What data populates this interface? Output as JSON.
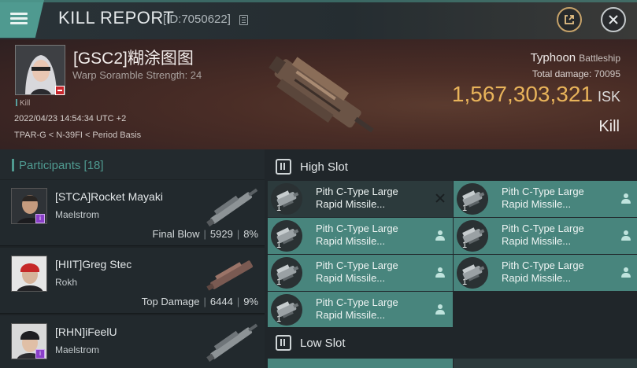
{
  "header": {
    "title": "KILL REPORT",
    "kill_id": "[ID:7050622]",
    "icons": {
      "menu": "hamburger-menu-icon",
      "copy": "copy-icon",
      "share": "share-icon",
      "close": "close-icon"
    }
  },
  "victim": {
    "name": "[GSC2]糊涂图图",
    "warp_scramble": "Warp Soramble Strength: 24",
    "status_tag": "Kill",
    "datetime": "2022/04/23 14:54:34 UTC +2",
    "location": "TPAR-G < N-39FI < Period Basis",
    "ship_name": "Typhoon",
    "ship_class": "Battleship",
    "total_damage_label": "Total damage:",
    "total_damage": "70095",
    "isk_value": "1,567,303,321",
    "isk_unit": "ISK",
    "result": "Kill"
  },
  "participants": {
    "header": "Participants [18]",
    "rows": [
      {
        "name": "[STCA]Rocket Mayaki",
        "ship": "Maelstrom",
        "tag": "Final Blow",
        "damage": "5929",
        "percent": "8%"
      },
      {
        "name": "[HIIT]Greg Stec",
        "ship": "Rokh",
        "tag": "Top Damage",
        "damage": "6444",
        "percent": "9%"
      },
      {
        "name": "[RHN]iFeelU",
        "ship": "Maelstrom",
        "tag": "",
        "damage": "",
        "percent": ""
      }
    ]
  },
  "slots": {
    "high_slot_label": "High Slot",
    "low_slot_label": "Low Slot",
    "high_modules": [
      {
        "line1": "Pith C-Type Large",
        "line2": "Rapid Missile...",
        "qty": "1",
        "state": "destroyed"
      },
      {
        "line1": "Pith C-Type Large",
        "line2": "Rapid Missile...",
        "qty": "1",
        "state": "dropped"
      },
      {
        "line1": "Pith C-Type Large",
        "line2": "Rapid Missile...",
        "qty": "1",
        "state": "dropped"
      },
      {
        "line1": "Pith C-Type Large",
        "line2": "Rapid Missile...",
        "qty": "1",
        "state": "dropped"
      },
      {
        "line1": "Pith C-Type Large",
        "line2": "Rapid Missile...",
        "qty": "1",
        "state": "dropped"
      },
      {
        "line1": "Pith C-Type Large",
        "line2": "Rapid Missile...",
        "qty": "1",
        "state": "dropped"
      },
      {
        "line1": "Pith C-Type Large",
        "line2": "Rapid Missile...",
        "qty": "1",
        "state": "dropped"
      }
    ]
  },
  "colors": {
    "accent": "#4f9a90",
    "isk": "#e8b35a",
    "dropped": "#48857d",
    "destroyed": "#2c3a3c"
  }
}
